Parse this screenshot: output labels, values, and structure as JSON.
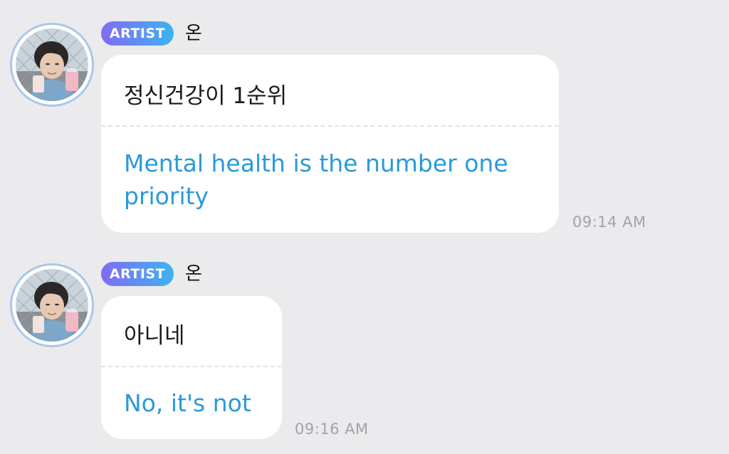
{
  "messages": [
    {
      "badge": "ARTIST",
      "sender": "온",
      "original": "정신건강이 1순위",
      "translation": "Mental health is the number one priority",
      "time": "09:14 AM"
    },
    {
      "badge": "ARTIST",
      "sender": "온",
      "original": "아니네",
      "translation": "No, it's not",
      "time": "09:16 AM"
    }
  ],
  "colors": {
    "background": "#ebebed",
    "bubble": "#ffffff",
    "translation_text": "#2a9ad8",
    "badge_gradient_start": "#7f6cf3",
    "badge_gradient_end": "#3bb4f0",
    "timestamp": "#a4a4a8"
  }
}
